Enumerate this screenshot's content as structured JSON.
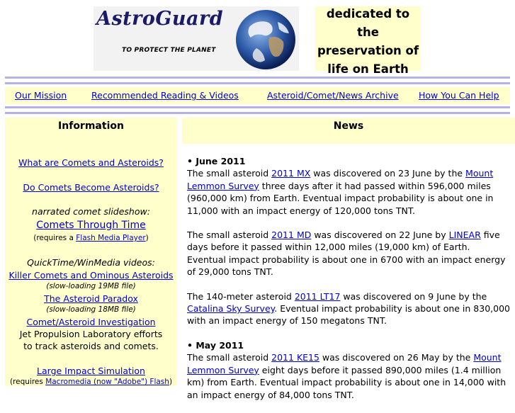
{
  "header": {
    "logo_title": "AstroGuard",
    "logo_tagline": "TO PROTECT THE PLANET",
    "dedication_lines": [
      "dedicated to the",
      "preservation of",
      "life on Earth"
    ]
  },
  "nav": {
    "mission": "Our Mission",
    "reading": "Recommended Reading & Videos",
    "archive": "Asteroid/Comet/News Archive",
    "help": "How You Can Help"
  },
  "sections": {
    "information": "Information",
    "news": "News"
  },
  "sidebar": {
    "link1": "What are Comets and Asteroids?",
    "link2": "Do Comets Become Asteroids?",
    "slideshow_label": "narrated comet slideshow:",
    "slideshow_link": "Comets Through Time",
    "requires_prefix": "(requires a ",
    "flash_player": "Flash Media Player",
    "requires_suffix": ")",
    "videos_label": "QuickTime/WinMedia videos:",
    "video1": "Killer Comets and Ominous Asteroids",
    "video1_note": "(slow-loading 19MB file)",
    "video2": "The Asteroid Paradox",
    "video2_note": "(slow-loading 18MB file)",
    "video3": "Comet/Asteroid Investigation",
    "jpl_line1": "Jet Propulsion Laboratory efforts",
    "jpl_line2": "to track asteroids and comets.",
    "sim_link": "Large Impact Simulation",
    "sim_req_prefix": "(requires ",
    "sim_req_link": "Macromedia (now \"Adobe\") Flash",
    "sim_req_suffix": ")"
  },
  "news": {
    "june_heading": "• June 2011",
    "e1_a": "The small asteroid ",
    "e1_link": "2011 MX",
    "e1_b": " was discovered on 23 June by the ",
    "e1_link2": "Mount Lemmon Survey",
    "e1_c": " three days after it had passed within 596,000 miles (960,000 km) from Earth. Eventual impact probability is about one in 11,000 with an impact energy of 120,000 tons TNT.",
    "e2_a": "The small asteroid ",
    "e2_link": "2011 MD",
    "e2_b": " was discovered on 22 June by ",
    "e2_link2": "LINEAR",
    "e2_c": " five days before it passed within 12,000 miles (19,000 km) of Earth. Eventual impact probability is about one in 6700 with an impact energy of 29,000 tons TNT.",
    "e3_a": "The 140-meter asteroid ",
    "e3_link": "2011 LT17",
    "e3_b": " was discovered on 9 June by the ",
    "e3_link2": "Catalina Sky Survey",
    "e3_c": ". Eventual impact probability is about one in 830,000 with an impact energy of 150 megatons TNT.",
    "may_heading": "• May 2011",
    "e4_a": "The small asteroid ",
    "e4_link": "2011 KE15",
    "e4_b": " was discovered on 26 May by the ",
    "e4_link2": "Mount Lemmon Survey",
    "e4_c": " eight days before it passed 890,000 miles (1.4 million km) from Earth. Eventual impact probability is about one in 14,000 with an impact energy of 84,000 tons TNT."
  },
  "colors": {
    "panel": "#ffffcc",
    "rule": "#b3b3e6",
    "link": "#0000cc"
  }
}
